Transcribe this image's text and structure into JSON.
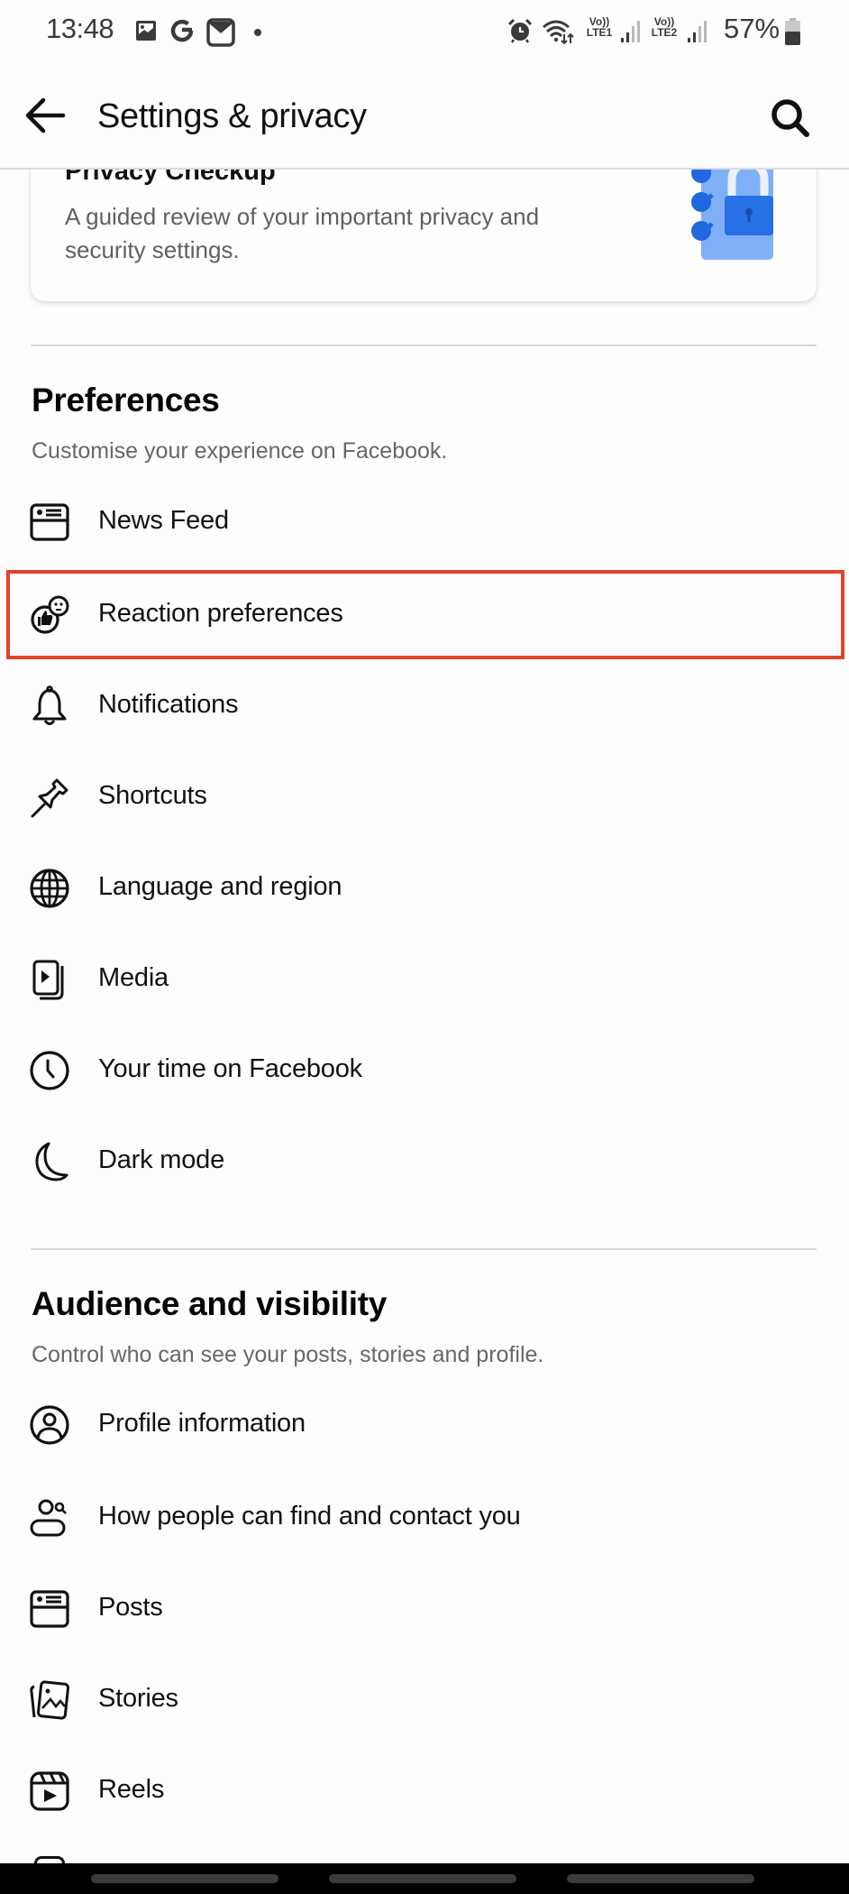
{
  "status_bar": {
    "time": "13:48",
    "left_icons": [
      "gallery-icon",
      "google-icon",
      "gmail-icon",
      "dot-icon"
    ],
    "right_icons": [
      "alarm-icon",
      "wifi-icon",
      "signal-sim1-icon",
      "signal-sim2-icon",
      "battery-icon"
    ],
    "sim1_label_top": "Vo))",
    "sim1_label_bottom": "LTE1",
    "sim2_label_top": "Vo))",
    "sim2_label_bottom": "LTE2",
    "battery": "57%",
    "battery_level": 0.57
  },
  "header": {
    "title": "Settings & privacy",
    "back_icon": "arrow-left-icon",
    "search_icon": "search-icon"
  },
  "privacy_checkup": {
    "title": "Privacy Checkup",
    "description": "A guided review of your important privacy and security settings.",
    "illustration": "checklist-lock-icon",
    "accent": "#1877f2"
  },
  "preferences": {
    "title": "Preferences",
    "subtitle": "Customise your experience on Facebook.",
    "items": [
      {
        "label": "News Feed",
        "icon": "news-feed-icon"
      },
      {
        "label": "Reaction preferences",
        "icon": "reaction-icon"
      },
      {
        "label": "Notifications",
        "icon": "bell-icon"
      },
      {
        "label": "Shortcuts",
        "icon": "pin-icon"
      },
      {
        "label": "Language and region",
        "icon": "globe-icon"
      },
      {
        "label": "Media",
        "icon": "media-icon"
      },
      {
        "label": "Your time on Facebook",
        "icon": "clock-icon"
      },
      {
        "label": "Dark mode",
        "icon": "moon-icon"
      }
    ]
  },
  "audience": {
    "title": "Audience and visibility",
    "subtitle": "Control who can see your posts, stories and profile.",
    "items": [
      {
        "label": "Profile information",
        "icon": "profile-icon"
      },
      {
        "label": "How people can find and contact you",
        "icon": "find-people-icon"
      },
      {
        "label": "Posts",
        "icon": "posts-icon"
      },
      {
        "label": "Stories",
        "icon": "stories-icon"
      },
      {
        "label": "Reels",
        "icon": "reels-icon"
      }
    ]
  },
  "highlight": {
    "target": "Reaction preferences",
    "color": "#e0452c"
  }
}
